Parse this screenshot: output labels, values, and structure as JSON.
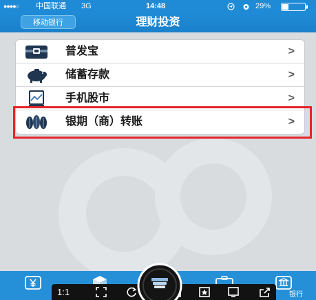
{
  "status_bar": {
    "signal": "●●●●○",
    "carrier": "中国联通",
    "network": "3G",
    "time": "14:48",
    "battery": "29%",
    "icons": [
      "location-icon",
      "alarm-icon",
      "battery-icon"
    ]
  },
  "header": {
    "back_button": "移动银行",
    "title": "理财投资"
  },
  "menu": {
    "items": [
      {
        "label": "普发宝",
        "icon": "cash-box-icon",
        "chevron": ">"
      },
      {
        "label": "储蓄存款",
        "icon": "piggy-bank-icon",
        "chevron": ">"
      },
      {
        "label": "手机股市",
        "icon": "stock-chart-icon",
        "chevron": ">"
      },
      {
        "label": "银期（商）转账",
        "icon": "transfer-coins-icon",
        "chevron": ">",
        "highlighted": true
      }
    ]
  },
  "tab_bar": {
    "right_label": "银行",
    "icons": [
      "yuan-tab-icon",
      "cube-tab-icon",
      "briefcase-tab-icon",
      "bank-tab-icon"
    ]
  },
  "viewer_toolbar": {
    "zoom_label": "1:1",
    "icons": [
      "fullscreen-icon",
      "rotate-icon",
      "capture-icon",
      "crop-icon",
      "favorite-icon",
      "window-icon",
      "share-icon"
    ]
  },
  "colors": {
    "header_blue": "#1f8bd6",
    "background": "#d9dcdf",
    "card": "#ffffff",
    "icon_navy": "#1f3550",
    "highlight_red": "#e62429",
    "tabbar_blue": "#2590d8"
  }
}
